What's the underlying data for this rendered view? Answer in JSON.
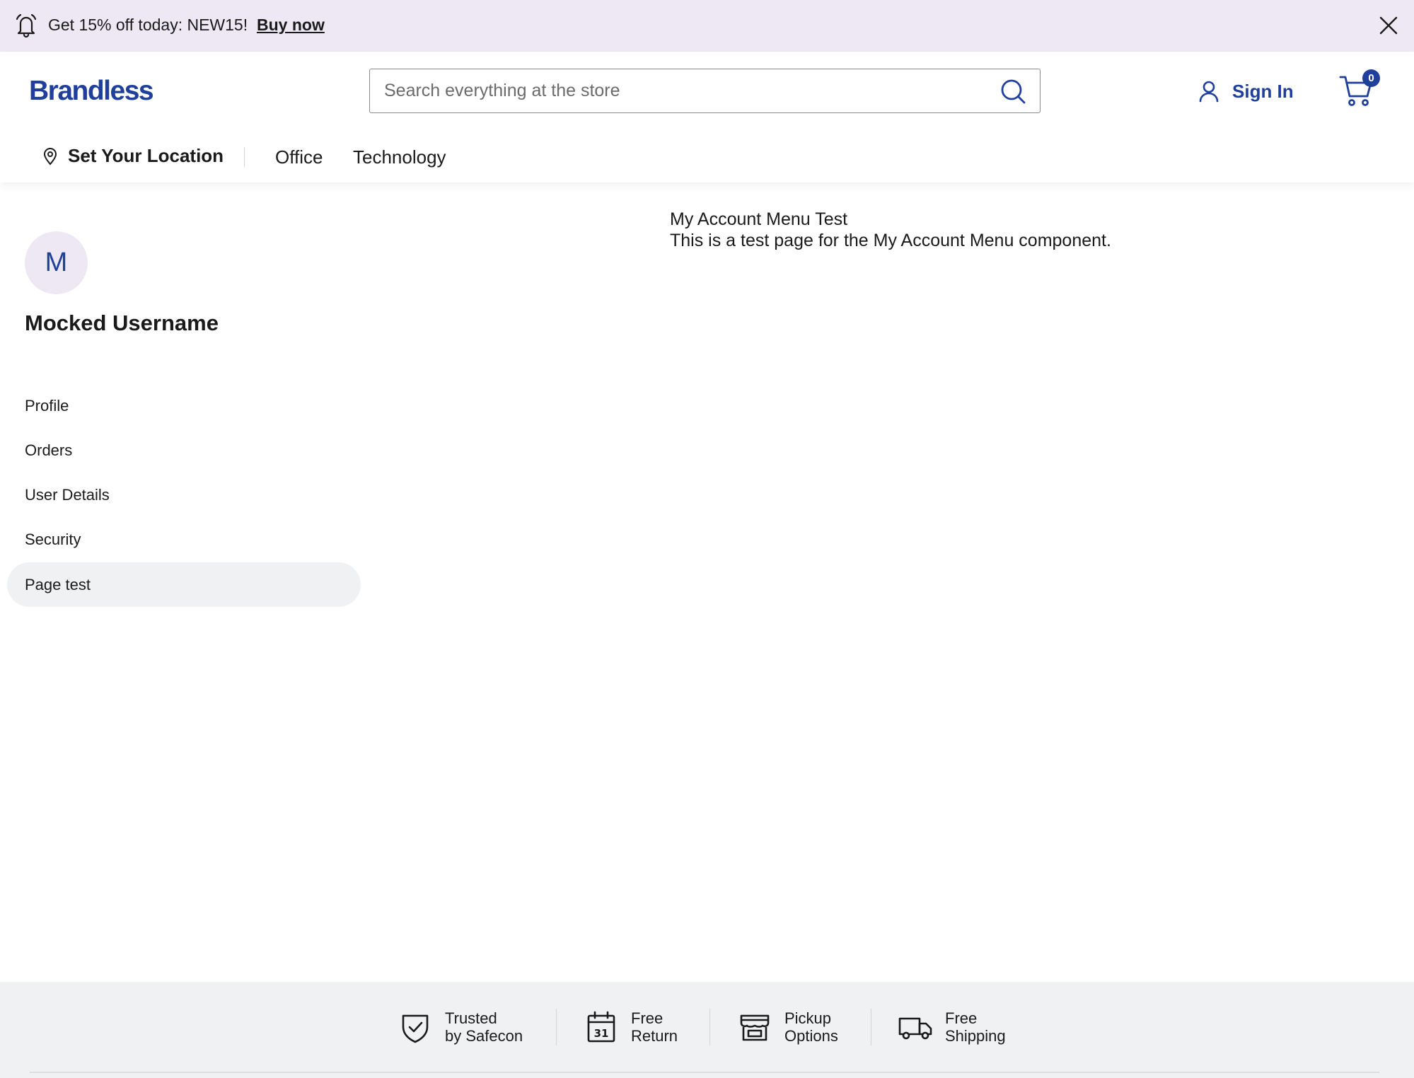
{
  "promo": {
    "text": "Get 15% off today: NEW15!",
    "link": "Buy now"
  },
  "header": {
    "logo": "Brandless",
    "search_placeholder": "Search everything at the store",
    "sign_in": "Sign In",
    "cart_count": "0"
  },
  "nav": {
    "location": "Set Your Location",
    "links": [
      "Office",
      "Technology"
    ]
  },
  "sidebar": {
    "avatar_initial": "M",
    "username": "Mocked Username",
    "items": [
      {
        "label": "Profile"
      },
      {
        "label": "Orders"
      },
      {
        "label": "User Details"
      },
      {
        "label": "Security"
      },
      {
        "label": "Page test",
        "active": true
      }
    ]
  },
  "main": {
    "title": "My Account Menu Test",
    "description": "This is a test page for the My Account Menu component."
  },
  "footer": {
    "features": [
      {
        "icon": "shield-check-icon",
        "line1": "Trusted",
        "line2": "by Safecon"
      },
      {
        "icon": "calendar-icon",
        "line1": "Free",
        "line2": "Return"
      },
      {
        "icon": "store-icon",
        "line1": "Pickup",
        "line2": "Options"
      },
      {
        "icon": "truck-icon",
        "line1": "Free",
        "line2": "Shipping"
      }
    ]
  },
  "colors": {
    "brand": "#1f3f9a",
    "promo_bg": "#ede8f4",
    "footer_bg": "#f0f1f3"
  }
}
